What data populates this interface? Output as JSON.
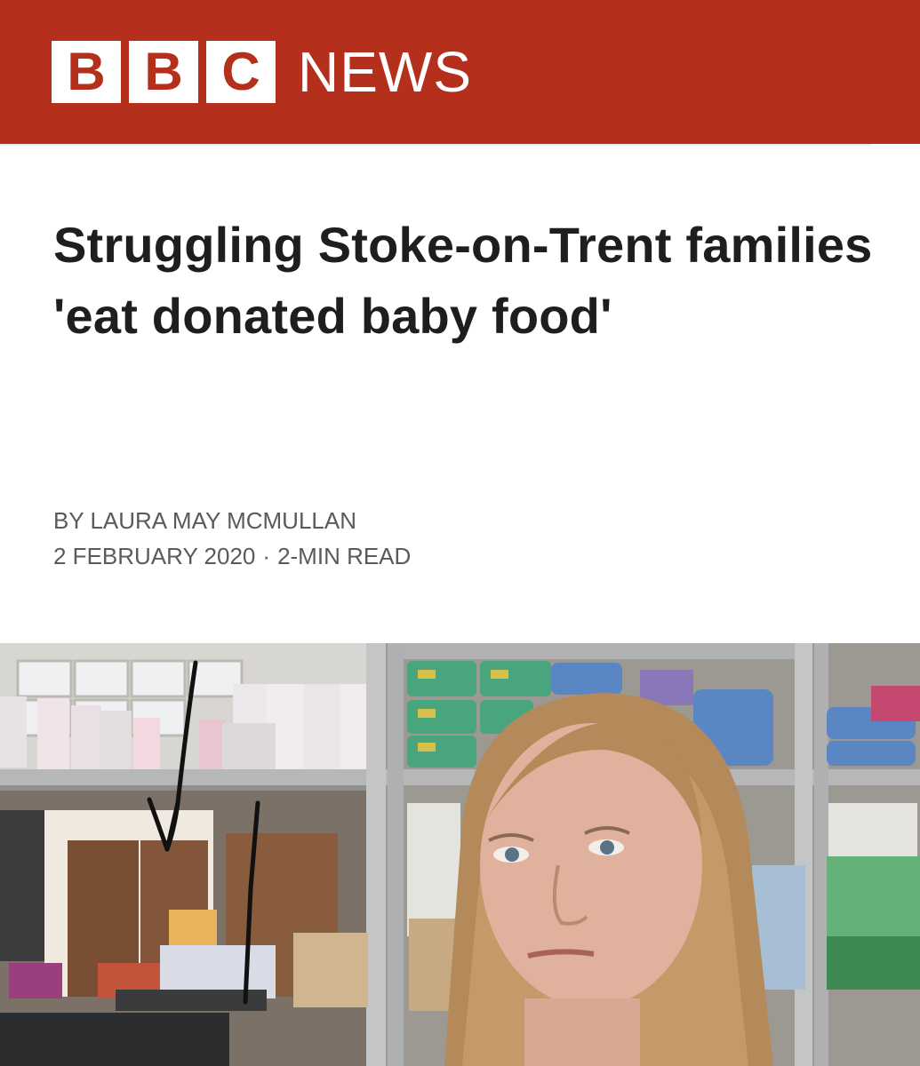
{
  "header": {
    "logo_letters": [
      "B",
      "B",
      "C"
    ],
    "logo_word": "NEWS",
    "background_color": "#b4301c"
  },
  "article": {
    "headline": "Struggling Stoke-on-Trent families 'eat donated baby food'",
    "byline": "BY LAURA MAY MCMULLAN",
    "date": "2 FEBRUARY 2020",
    "separator": "·",
    "read_time": "2-MIN READ"
  },
  "photo": {
    "description_icon": "photo-food-bank-woman",
    "overlay_arrows": 2
  }
}
